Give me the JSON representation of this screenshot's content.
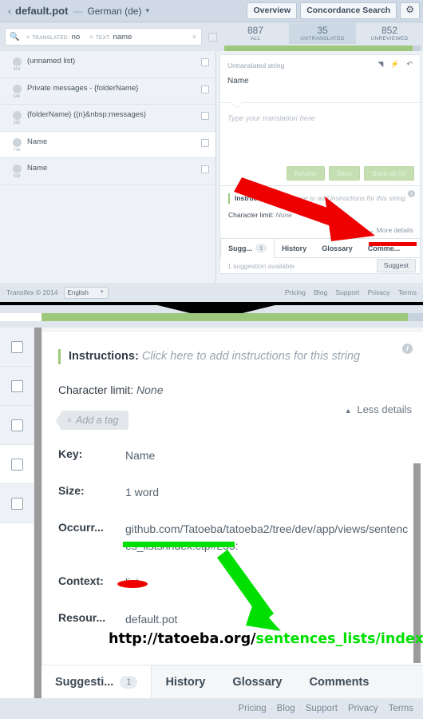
{
  "header": {
    "back_icon": "chevron-left-icon",
    "title": "default.pot",
    "dash": "—",
    "language": "German (de)",
    "caret_icon": "chevron-down-icon",
    "overview_label": "Overview",
    "concordance_label": "Concordance Search",
    "gear_icon": "⚙"
  },
  "filters": {
    "search_icon": "search-icon",
    "chips": [
      {
        "key": "TRANSLATED:",
        "value": "no",
        "remove_icon": "×"
      },
      {
        "key": "TEXT:",
        "value": "name",
        "remove_icon": "×"
      }
    ],
    "clear_icon": "×"
  },
  "counters": [
    {
      "num": "887",
      "label": "ALL",
      "active": false
    },
    {
      "num": "35",
      "label": "UNTRANSLATED",
      "active": true
    },
    {
      "num": "852",
      "label": "UNREVIEWED",
      "active": false
    }
  ],
  "progress": {
    "percent": 96,
    "fill_color": "#9dc87c",
    "track_color": "#c6d2de"
  },
  "string_list": [
    {
      "num": "414",
      "text": "(unnamed list)",
      "selected": false
    },
    {
      "num": "649",
      "text": "Private messages - {folderName}",
      "selected": false
    },
    {
      "num": "650",
      "text": "{folderName} ({n}&nbsp;messages)",
      "selected": false
    },
    {
      "num": "718",
      "text": "Name",
      "selected": true
    },
    {
      "num": "818",
      "text": "Name",
      "selected": false
    }
  ],
  "editor": {
    "source_label": "Untranslated string",
    "source_text": "Name",
    "target_placeholder": "Type your translation here",
    "icons": [
      {
        "name": "copy-source-icon",
        "glyph": "◥"
      },
      {
        "name": "auto-translate-icon",
        "glyph": "⚡"
      },
      {
        "name": "undo-icon",
        "glyph": "↶"
      }
    ],
    "buttons": [
      {
        "name": "review-button",
        "label": "Review"
      },
      {
        "name": "save-button",
        "label": "Save"
      },
      {
        "name": "save-all-button",
        "label": "Save all (0)"
      }
    ]
  },
  "details_top": {
    "info_icon": "i",
    "instructions_label": "Instructions:",
    "instructions_placeholder": "Click here to add instructions for this string",
    "char_limit_label": "Character limit:",
    "char_limit_value": "None",
    "more_details": "More details",
    "more_caret": "⌄"
  },
  "tabs_top": [
    {
      "label": "Sugg...",
      "badge": "1",
      "active": true
    },
    {
      "label": "History",
      "badge": "",
      "active": false
    },
    {
      "label": "Glossary",
      "badge": "",
      "active": false
    },
    {
      "label": "Comme...",
      "badge": "",
      "active": false
    }
  ],
  "suggestions_top": {
    "status": "1 suggestion available",
    "suggest_button": "Suggest"
  },
  "footer_top": {
    "copyright": "Transifex © 2014",
    "sep": "·",
    "language_value": "English",
    "language_caret": "▼",
    "links": [
      "Pricing",
      "Blog",
      "Support",
      "Privacy",
      "Terms"
    ]
  },
  "details_bottom": {
    "info_icon": "i",
    "instructions_label": "Instructions:",
    "instructions_placeholder": "Click here to add instructions for this string",
    "char_limit_label": "Character limit:",
    "char_limit_value": "None",
    "less_details": "Less details",
    "less_caret": "▲",
    "add_tag": "Add a tag",
    "rows": [
      {
        "key": "Key:",
        "value": "Name"
      },
      {
        "key": "Size:",
        "value": "1 word"
      },
      {
        "key": "Occurr...",
        "value": "github.com/Tatoeba/tatoeba2/tree/dev/app/views/sentences_lists/index.ctp#L55:"
      },
      {
        "key": "Context:",
        "value": "list"
      },
      {
        "key": "Resour...",
        "value": "default.pot"
      }
    ]
  },
  "tabs_bottom": [
    {
      "label": "Suggesti...",
      "badge": "1",
      "active": true
    },
    {
      "label": "History",
      "badge": "",
      "active": false
    },
    {
      "label": "Glossary",
      "badge": "",
      "active": false
    },
    {
      "label": "Comments",
      "badge": "",
      "active": false
    }
  ],
  "footer_bottom": {
    "links": [
      "Pricing",
      "Blog",
      "Support",
      "Privacy",
      "Terms"
    ],
    "sep": "·"
  },
  "annotations": {
    "red_color": "#ee0000",
    "green_color": "#00e000",
    "url_black": "http://tatoeba.org/",
    "url_green": "sentences_lists/index"
  }
}
